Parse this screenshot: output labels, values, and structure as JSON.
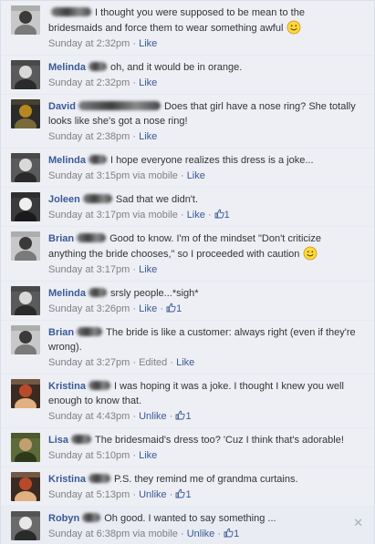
{
  "comments": [
    {
      "first": "",
      "sur_w": 44,
      "text": "I thought you were supposed to be mean to the bridesmaids and force them to wear something awful",
      "emoticon": true,
      "time": "Sunday at 2:32pm",
      "via": "",
      "action": "Like",
      "edited": "",
      "likes": "",
      "avatar": {
        "bg": "#c8c8c8",
        "fg": "#3a3a3a",
        "accent": "#7a7a7a"
      }
    },
    {
      "first": "Melinda",
      "sur_w": 20,
      "text": "oh, and it would be in orange.",
      "emoticon": false,
      "time": "Sunday at 2:32pm",
      "via": "",
      "action": "Like",
      "edited": "",
      "likes": "",
      "avatar": {
        "bg": "#5a5a5a",
        "fg": "#d9d9d9",
        "accent": "#2a2a2a"
      }
    },
    {
      "first": "David",
      "sur_w": 90,
      "text": "Does that girl have a nose ring? She totally looks like she's got a nose ring!",
      "emoticon": false,
      "time": "Sunday at 2:38pm",
      "via": "",
      "action": "Like",
      "edited": "",
      "likes": "",
      "avatar": {
        "bg": "#2b2b2b",
        "fg": "#b5891f",
        "accent": "#7a6a3a"
      }
    },
    {
      "first": "Melinda",
      "sur_w": 20,
      "text": "I hope everyone realizes this dress is a joke...",
      "emoticon": false,
      "time": "Sunday at 3:15pm",
      "via": "via mobile",
      "action": "Like",
      "edited": "",
      "likes": "",
      "avatar": {
        "bg": "#5a5a5a",
        "fg": "#d9d9d9",
        "accent": "#2a2a2a"
      }
    },
    {
      "first": "Joleen",
      "sur_w": 32,
      "text": "Sad that we didn't.",
      "emoticon": false,
      "time": "Sunday at 3:17pm",
      "via": "via mobile",
      "action": "Like",
      "edited": "",
      "likes": "1",
      "avatar": {
        "bg": "#3b3b3b",
        "fg": "#efefef",
        "accent": "#1a1a1a"
      }
    },
    {
      "first": "Brian",
      "sur_w": 32,
      "text": "Good to know. I'm of the mindset \"Don't criticize anything the bride chooses,\" so I proceeded with caution",
      "emoticon": true,
      "time": "Sunday at 3:17pm",
      "via": "",
      "action": "Like",
      "edited": "",
      "likes": "",
      "avatar": {
        "bg": "#c8c8c8",
        "fg": "#3a3a3a",
        "accent": "#7a7a7a"
      }
    },
    {
      "first": "Melinda",
      "sur_w": 20,
      "text": "srsly people...*sigh*",
      "emoticon": false,
      "time": "Sunday at 3:26pm",
      "via": "",
      "action": "Like",
      "edited": "",
      "likes": "1",
      "avatar": {
        "bg": "#5a5a5a",
        "fg": "#d9d9d9",
        "accent": "#2a2a2a"
      }
    },
    {
      "first": "Brian",
      "sur_w": 28,
      "text": "The bride is like a customer: always right (even if they're wrong).",
      "emoticon": false,
      "time": "Sunday at 3:27pm",
      "via": "",
      "action": "Like",
      "edited": "Edited",
      "likes": "",
      "avatar": {
        "bg": "#c8c8c8",
        "fg": "#3a3a3a",
        "accent": "#7a7a7a"
      }
    },
    {
      "first": "Kristina",
      "sur_w": 24,
      "text": "I was hoping it was a joke. I thought I knew you well enough to know that.",
      "emoticon": false,
      "time": "Sunday at 4:43pm",
      "via": "",
      "action": "Unlike",
      "edited": "",
      "likes": "1",
      "avatar": {
        "bg": "#3a2a22",
        "fg": "#b84a2a",
        "accent": "#e0b080"
      }
    },
    {
      "first": "Lisa",
      "sur_w": 22,
      "text": "The bridesmaid's dress too? 'Cuz I think that's adorable!",
      "emoticon": false,
      "time": "Sunday at 5:10pm",
      "via": "",
      "action": "Like",
      "edited": "",
      "likes": "",
      "avatar": {
        "bg": "#5e6a3a",
        "fg": "#c0a070",
        "accent": "#2d3a1a"
      }
    },
    {
      "first": "Kristina",
      "sur_w": 24,
      "text": "P.S. they remind me of grandma curtains.",
      "emoticon": false,
      "time": "Sunday at 5:13pm",
      "via": "",
      "action": "Unlike",
      "edited": "",
      "likes": "1",
      "avatar": {
        "bg": "#3a2a22",
        "fg": "#b84a2a",
        "accent": "#e0b080"
      }
    },
    {
      "first": "Robyn",
      "sur_w": 20,
      "text": "Oh good. I wanted to say something ...",
      "emoticon": false,
      "time": "Sunday at 6:38pm",
      "via": "via mobile",
      "action": "Unlike",
      "edited": "",
      "likes": "1",
      "avatar": {
        "bg": "#6a6a6a",
        "fg": "#e8e8e8",
        "accent": "#2a2a2a"
      }
    }
  ],
  "close_glyph": "✕",
  "separator": "·",
  "colors": {
    "link": "#3b5998",
    "meta": "#808080",
    "background": "#edeff4",
    "text": "#333333"
  }
}
